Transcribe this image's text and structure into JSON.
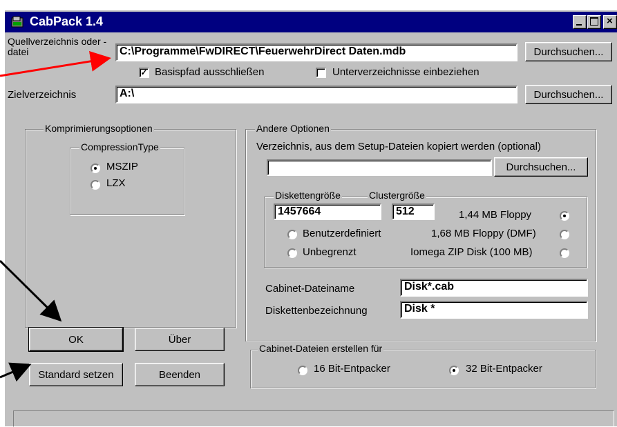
{
  "window": {
    "title": "CabPack 1.4",
    "source_label": "Quellverzeichnis oder -datei",
    "source_value": "C:\\Programme\\FwDIRECT\\FeuerwehrDirect Daten.mdb",
    "browse_label": "Durchsuchen...",
    "basepath_label": "Basispfad ausschließen",
    "basepath_checked": true,
    "subdirs_label": "Unterverzeichnisse einbeziehen",
    "subdirs_checked": false,
    "target_label": "Zielverzeichnis",
    "target_value": "A:\\"
  },
  "compression": {
    "group_title": "Komprimierungsoptionen",
    "type_title": "CompressionType",
    "options": [
      {
        "label": "MSZIP",
        "selected": true
      },
      {
        "label": "LZX",
        "selected": false
      }
    ]
  },
  "other": {
    "group_title": "Andere Optionen",
    "setup_dir_label": "Verzeichnis, aus dem Setup-Dateien kopiert werden (optional)",
    "setup_dir_value": "",
    "browse_label": "Durchsuchen...",
    "disk_size_label": "Diskettengröße",
    "cluster_size_label": "Clustergröße",
    "disk_size_value": "1457664",
    "cluster_size_value": "512",
    "size_options": [
      {
        "label": "1,44 MB Floppy",
        "selected": true
      },
      {
        "label": "1,68 MB Floppy (DMF)",
        "selected": false
      },
      {
        "label": "Iomega ZIP Disk (100 MB)",
        "selected": false
      },
      {
        "label": "Benutzerdefiniert",
        "selected": false
      },
      {
        "label": "Unbegrenzt",
        "selected": false
      }
    ],
    "cabinet_name_label": "Cabinet-Dateiname",
    "cabinet_name_value": "Disk*.cab",
    "disk_label_label": "Diskettenbezeichnung",
    "disk_label_value": "Disk *"
  },
  "create_for": {
    "group_title": "Cabinet-Dateien erstellen für",
    "options": [
      {
        "label": "16 Bit-Entpacker",
        "selected": false
      },
      {
        "label": "32 Bit-Entpacker",
        "selected": true
      }
    ]
  },
  "buttons": {
    "ok": "OK",
    "about": "Über",
    "defaults": "Standard setzen",
    "exit": "Beenden"
  },
  "colors": {
    "titlebar": "#000080",
    "face": "#c0c0c0",
    "arrow_red": "#ff0000"
  }
}
